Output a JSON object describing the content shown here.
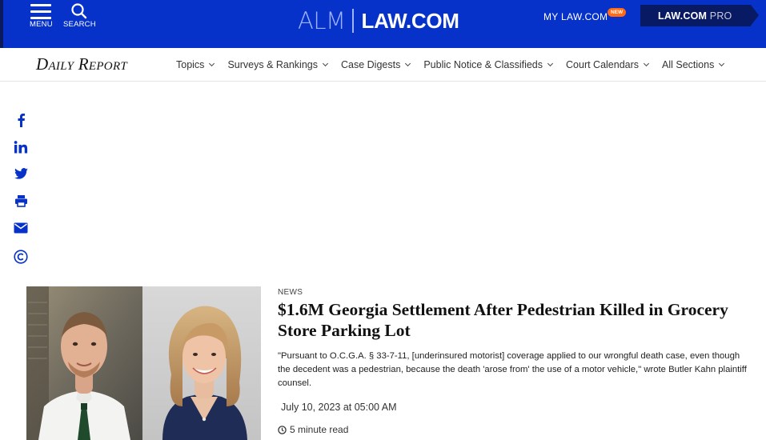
{
  "topbar": {
    "menu_label": "MENU",
    "search_label": "SEARCH",
    "logo_alm": "ALM",
    "logo_law": "LAW.COM",
    "mylaw_label": "MY LAW.COM",
    "new_badge": "NEW",
    "pro_label_main": "LAW.COM",
    "pro_label_suffix": " PRO",
    "colors": {
      "bar": "#0632c9",
      "pro_button": "#071a63",
      "badge": "#ff6a13"
    }
  },
  "navbar": {
    "brand": "Daily Report",
    "items": [
      {
        "label": "Topics"
      },
      {
        "label": "Surveys & Rankings"
      },
      {
        "label": "Case Digests"
      },
      {
        "label": "Public Notice & Classifieds"
      },
      {
        "label": "Court Calendars"
      },
      {
        "label": "All Sections"
      }
    ]
  },
  "share": {
    "icons": [
      "facebook-icon",
      "linkedin-icon",
      "twitter-icon",
      "print-icon",
      "email-icon",
      "copyright-icon"
    ],
    "color": "#0632c9"
  },
  "article": {
    "category": "NEWS",
    "headline": "$1.6M Georgia Settlement After Pedestrian Killed in Grocery Store Parking Lot",
    "summary": "\"Pursuant to O.C.G.A. § 33-7-11, [underinsured motorist] coverage applied to our wrongful death case, even though the decedent was a pedestrian, because the death 'arose from' the use of a motor vehicle,\" wrote Butler Kahn plaintiff counsel.",
    "date": "July 10, 2023 at 05:00 AM",
    "read_time": "5 minute read"
  }
}
